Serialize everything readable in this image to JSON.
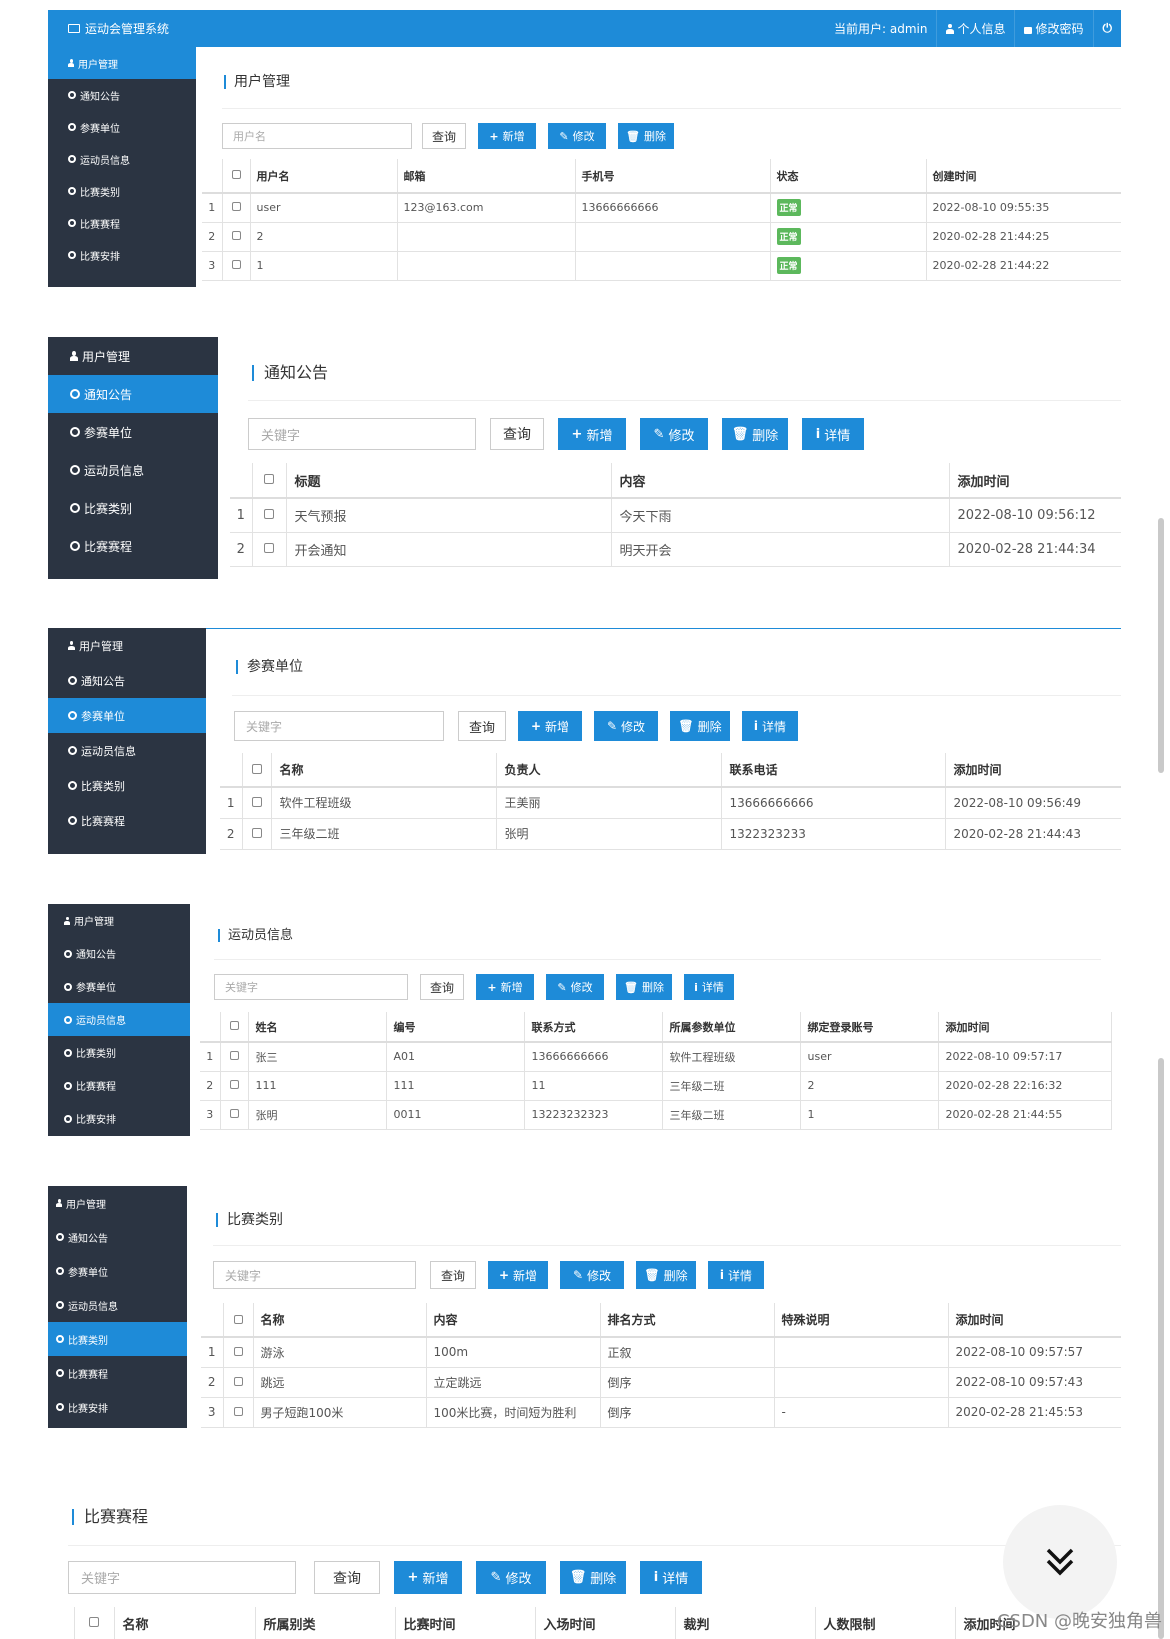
{
  "app": {
    "brand": "运动会管理系统",
    "current_user": "当前用户: admin",
    "profile": "个人信息",
    "change_password": "修改密码"
  },
  "nav_all": [
    "用户管理",
    "通知公告",
    "参赛单位",
    "运动员信息",
    "比赛类别",
    "比赛赛程",
    "比赛安排"
  ],
  "nav_short": [
    "用户管理",
    "通知公告",
    "参赛单位",
    "运动员信息",
    "比赛类别",
    "比赛赛程"
  ],
  "buttons": {
    "query": "查询",
    "add": "新增",
    "edit": "修改",
    "delete": "删除",
    "detail": "详情"
  },
  "users": {
    "title": "用户管理",
    "placeholder": "用户名",
    "headers": [
      "用户名",
      "邮箱",
      "手机号",
      "状态",
      "创建时间"
    ],
    "status_label": "正常",
    "rows": [
      {
        "n": "1",
        "c": [
          "user",
          "123@163.com",
          "13666666666",
          "正常",
          "2022-08-10 09:55:35"
        ]
      },
      {
        "n": "2",
        "c": [
          "2",
          "",
          "",
          "正常",
          "2020-02-28 21:44:25"
        ]
      },
      {
        "n": "3",
        "c": [
          "1",
          "",
          "",
          "正常",
          "2020-02-28 21:44:22"
        ]
      }
    ]
  },
  "notice": {
    "title": "通知公告",
    "placeholder": "关键字",
    "headers": [
      "标题",
      "内容",
      "添加时间"
    ],
    "rows": [
      {
        "n": "1",
        "c": [
          "天气预报",
          "今天下雨",
          "2022-08-10 09:56:12"
        ]
      },
      {
        "n": "2",
        "c": [
          "开会通知",
          "明天开会",
          "2020-02-28 21:44:34"
        ]
      }
    ]
  },
  "units": {
    "title": "参赛单位",
    "placeholder": "关键字",
    "headers": [
      "名称",
      "负责人",
      "联系电话",
      "添加时间"
    ],
    "rows": [
      {
        "n": "1",
        "c": [
          "软件工程班级",
          "王美丽",
          "13666666666",
          "2022-08-10 09:56:49"
        ]
      },
      {
        "n": "2",
        "c": [
          "三年级二班",
          "张明",
          "1322323233",
          "2020-02-28 21:44:43"
        ]
      }
    ]
  },
  "athletes": {
    "title": "运动员信息",
    "placeholder": "关键字",
    "headers": [
      "姓名",
      "编号",
      "联系方式",
      "所属参数单位",
      "绑定登录账号",
      "添加时间"
    ],
    "rows": [
      {
        "n": "1",
        "c": [
          "张三",
          "A01",
          "13666666666",
          "软件工程班级",
          "user",
          "2022-08-10 09:57:17"
        ]
      },
      {
        "n": "2",
        "c": [
          "111",
          "111",
          "11",
          "三年级二班",
          "2",
          "2020-02-28 22:16:32"
        ]
      },
      {
        "n": "3",
        "c": [
          "张明",
          "0011",
          "13223232323",
          "三年级二班",
          "1",
          "2020-02-28 21:44:55"
        ]
      }
    ]
  },
  "categories": {
    "title": "比赛类别",
    "placeholder": "关键字",
    "headers": [
      "名称",
      "内容",
      "排名方式",
      "特殊说明",
      "添加时间"
    ],
    "rows": [
      {
        "n": "1",
        "c": [
          "游泳",
          "100m",
          "正叙",
          "",
          "2022-08-10 09:57:57"
        ]
      },
      {
        "n": "2",
        "c": [
          "跳远",
          "立定跳远",
          "倒序",
          "",
          "2022-08-10 09:57:43"
        ]
      },
      {
        "n": "3",
        "c": [
          "男子短跑100米",
          "100米比赛，时间短为胜利",
          "倒序",
          "-",
          "2020-02-28 21:45:53"
        ]
      }
    ]
  },
  "schedule": {
    "title": "比赛赛程",
    "placeholder": "关键字",
    "headers": [
      "名称",
      "所属别类",
      "比赛时间",
      "入场时间",
      "裁判",
      "人数限制",
      "添加时间"
    ]
  },
  "watermark": "CSDN @晚安独角兽",
  "colors": {
    "primary": "#1e8bd8",
    "sidebar": "#2b3442",
    "success": "#5cb85c"
  }
}
